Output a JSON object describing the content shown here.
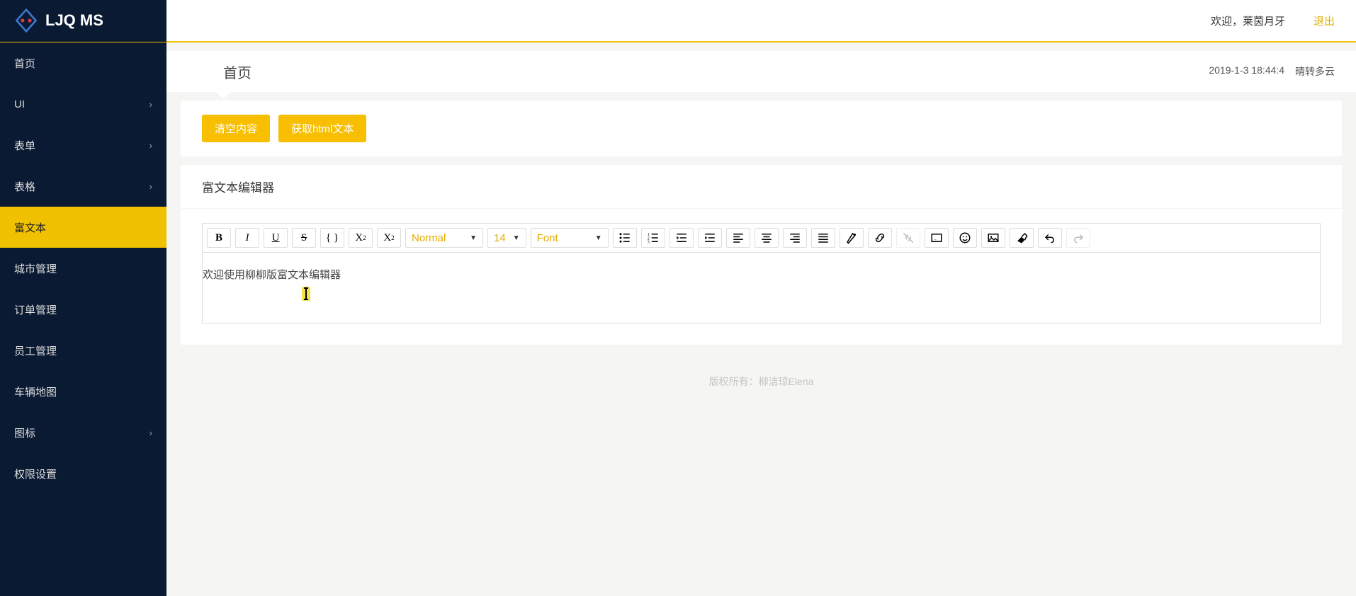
{
  "header": {
    "app_title": "LJQ MS",
    "welcome": "欢迎，莱茵月牙",
    "logout": "退出"
  },
  "breadcrumb": {
    "title": "首页",
    "timestamp": "2019-1-3 18:44:4",
    "weather": "晴转多云"
  },
  "sidebar": {
    "items": [
      {
        "label": "首页",
        "has_children": false
      },
      {
        "label": "UI",
        "has_children": true
      },
      {
        "label": "表单",
        "has_children": true
      },
      {
        "label": "表格",
        "has_children": true
      },
      {
        "label": "富文本",
        "has_children": false,
        "active": true
      },
      {
        "label": "城市管理",
        "has_children": false
      },
      {
        "label": "订单管理",
        "has_children": false
      },
      {
        "label": "员工管理",
        "has_children": false
      },
      {
        "label": "车辆地图",
        "has_children": false
      },
      {
        "label": "图标",
        "has_children": true
      },
      {
        "label": "权限设置",
        "has_children": false
      }
    ]
  },
  "buttons": {
    "clear": "清空内容",
    "get_html": "获取html文本"
  },
  "panel": {
    "title": "富文本编辑器"
  },
  "toolbar": {
    "header_select": "Normal",
    "size_select": "14",
    "font_select": "Font"
  },
  "editor": {
    "content": "欢迎使用柳柳版富文本编辑器"
  },
  "footer": {
    "copyright": "版权所有：柳洁琼Elena"
  }
}
